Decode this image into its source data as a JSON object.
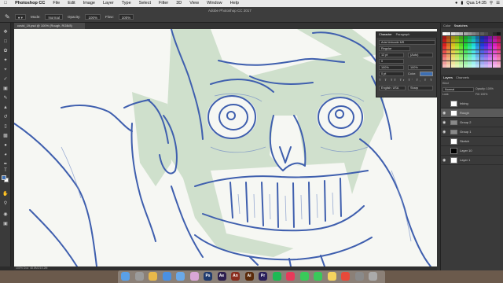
{
  "menubar": {
    "app": "Photoshop CC",
    "items": [
      "File",
      "Edit",
      "Image",
      "Layer",
      "Type",
      "Select",
      "Filter",
      "3D",
      "View",
      "Window",
      "Help"
    ],
    "clock": "Qua 14:35"
  },
  "options": {
    "window_title": "Adobe Photoshop CC 2017",
    "mode_label": "Mode:",
    "mode_value": "Normal",
    "opacity_label": "Opacity:",
    "opacity_value": "100%",
    "flow_label": "Flow:",
    "flow_value": "100%"
  },
  "document": {
    "tab": "covid_19.psd @ 100% (Rough, RGB/8)",
    "status": "100%   Doc: 48.8M/215.2M"
  },
  "character": {
    "tabs": [
      "Character",
      "Paragraph"
    ],
    "font_family": "Arial Unicode MS",
    "font_style": "Regular",
    "size": "12 pt",
    "leading": "(Auto)",
    "tracking": "0",
    "scale_v": "100%",
    "scale_h": "100%",
    "baseline": "0 pt",
    "color_label": "Color:",
    "styles": "T T TT Tr T' T, T T",
    "lang": "English: USA",
    "aa": "Sharp"
  },
  "panels": {
    "top_tabs": [
      "Color",
      "Swatches"
    ],
    "layers_tabs": [
      "Layers",
      "Channels"
    ],
    "kind": "Kind",
    "blend": "Normal",
    "opacity": "Opacity: 100%",
    "fill": "Fill: 100%",
    "lock": "Lock:"
  },
  "layers": [
    {
      "name": "Inking",
      "visible": false,
      "selected": false,
      "thumb": "#ffffff"
    },
    {
      "name": "Rough",
      "visible": true,
      "selected": true,
      "thumb": "#ffffff"
    },
    {
      "name": "Group 2",
      "visible": true,
      "selected": false,
      "thumb": "folder"
    },
    {
      "name": "Group 1",
      "visible": true,
      "selected": false,
      "thumb": "folder"
    },
    {
      "name": "Sketch",
      "visible": false,
      "selected": false,
      "thumb": "#ffffff"
    },
    {
      "name": "Layer 10",
      "visible": false,
      "selected": false,
      "thumb": "#000000"
    },
    {
      "name": "Layer 1",
      "visible": true,
      "selected": false,
      "thumb": "#ffffff"
    }
  ],
  "colors": {
    "sketch_line": "#3f5fae",
    "sketch_fill": "#c9dcc6",
    "fg_swatch": "#3d6fb3"
  },
  "dock_apps": [
    "Finder",
    "Launchpad",
    "Chrome",
    "Safari",
    "Mail",
    "Photos",
    "Photoshop",
    "After Effects",
    "Animate",
    "Illustrator",
    "Premiere",
    "Spotify",
    "Music",
    "Messages",
    "FaceTime",
    "Notes",
    "Calendar",
    "Settings",
    "Trash"
  ]
}
